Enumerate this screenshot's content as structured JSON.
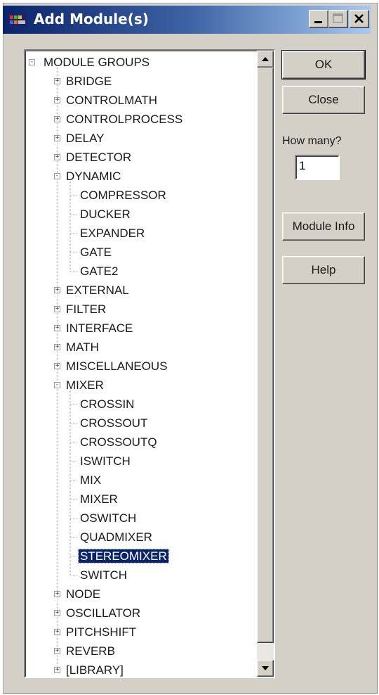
{
  "window": {
    "title": "Add Module(s)"
  },
  "titlebar": {
    "minimize": "minimize",
    "maximize": "maximize",
    "close": "close"
  },
  "tree": {
    "root": "MODULE GROUPS",
    "rows": [
      {
        "label": "MODULE GROUPS",
        "depth": 0,
        "toggle": "-"
      },
      {
        "label": "BRIDGE",
        "depth": 1,
        "toggle": "+"
      },
      {
        "label": "CONTROLMATH",
        "depth": 1,
        "toggle": "+"
      },
      {
        "label": "CONTROLPROCESS",
        "depth": 1,
        "toggle": "+"
      },
      {
        "label": "DELAY",
        "depth": 1,
        "toggle": "+"
      },
      {
        "label": "DETECTOR",
        "depth": 1,
        "toggle": "+"
      },
      {
        "label": "DYNAMIC",
        "depth": 1,
        "toggle": "-"
      },
      {
        "label": "COMPRESSOR",
        "depth": 2,
        "toggle": ""
      },
      {
        "label": "DUCKER",
        "depth": 2,
        "toggle": ""
      },
      {
        "label": "EXPANDER",
        "depth": 2,
        "toggle": ""
      },
      {
        "label": "GATE",
        "depth": 2,
        "toggle": ""
      },
      {
        "label": "GATE2",
        "depth": 2,
        "toggle": ""
      },
      {
        "label": "EXTERNAL",
        "depth": 1,
        "toggle": "+"
      },
      {
        "label": "FILTER",
        "depth": 1,
        "toggle": "+"
      },
      {
        "label": "INTERFACE",
        "depth": 1,
        "toggle": "+"
      },
      {
        "label": "MATH",
        "depth": 1,
        "toggle": "+"
      },
      {
        "label": "MISCELLANEOUS",
        "depth": 1,
        "toggle": "+"
      },
      {
        "label": "MIXER",
        "depth": 1,
        "toggle": "-"
      },
      {
        "label": "CROSSIN",
        "depth": 2,
        "toggle": ""
      },
      {
        "label": "CROSSOUT",
        "depth": 2,
        "toggle": ""
      },
      {
        "label": "CROSSOUTQ",
        "depth": 2,
        "toggle": ""
      },
      {
        "label": "ISWITCH",
        "depth": 2,
        "toggle": ""
      },
      {
        "label": "MIX",
        "depth": 2,
        "toggle": ""
      },
      {
        "label": "MIXER",
        "depth": 2,
        "toggle": ""
      },
      {
        "label": "OSWITCH",
        "depth": 2,
        "toggle": ""
      },
      {
        "label": "QUADMIXER",
        "depth": 2,
        "toggle": ""
      },
      {
        "label": "STEREOMIXER",
        "depth": 2,
        "toggle": "",
        "selected": true
      },
      {
        "label": "SWITCH",
        "depth": 2,
        "toggle": ""
      },
      {
        "label": "NODE",
        "depth": 1,
        "toggle": "+"
      },
      {
        "label": "OSCILLATOR",
        "depth": 1,
        "toggle": "+"
      },
      {
        "label": "PITCHSHIFT",
        "depth": 1,
        "toggle": "+"
      },
      {
        "label": "REVERB",
        "depth": 1,
        "toggle": "+"
      },
      {
        "label": "[LIBRARY]",
        "depth": 1,
        "toggle": "+"
      }
    ]
  },
  "buttons": {
    "ok": "OK",
    "close": "Close",
    "module_info": "Module Info",
    "help": "Help"
  },
  "how_many": {
    "label": "How many?",
    "value": "1"
  },
  "colors": {
    "selection": "#0a246a",
    "titlebar_start": "#0a246a",
    "face": "#d4d0c8"
  }
}
